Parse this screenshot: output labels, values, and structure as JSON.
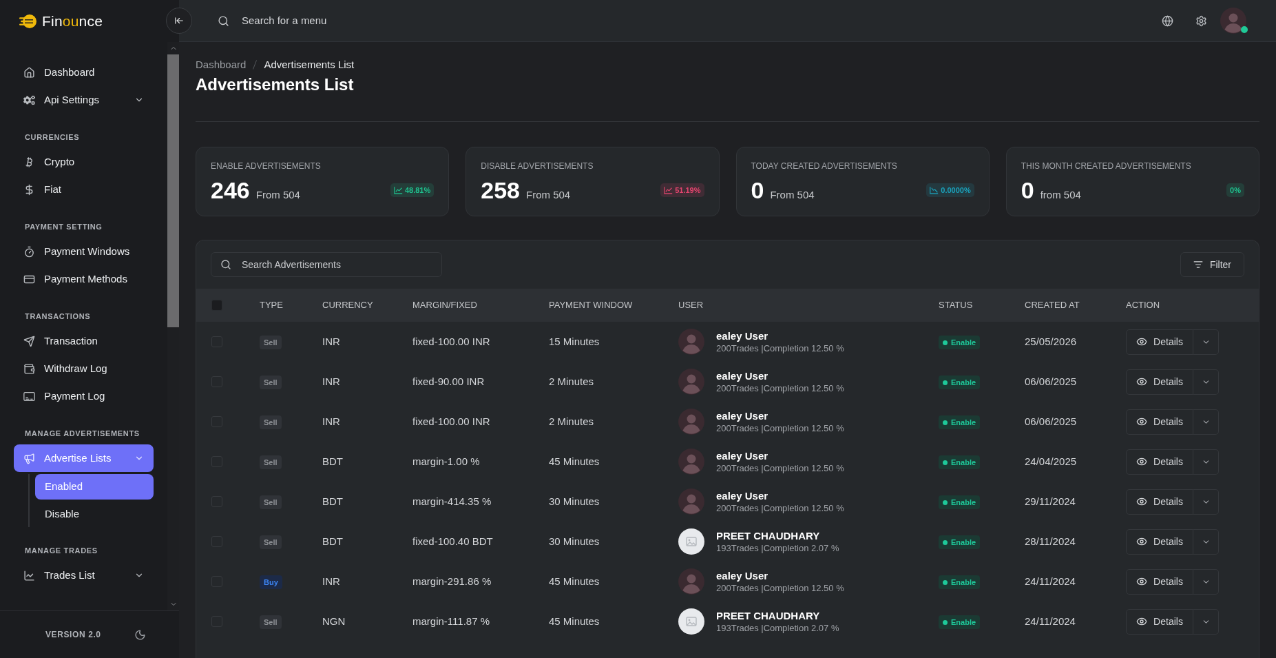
{
  "sidebar": {
    "logo": {
      "parts": [
        {
          "text": "Fin",
          "accent": false
        },
        {
          "text": "ou",
          "accent": true
        },
        {
          "text": "nce",
          "accent": false
        }
      ]
    },
    "sections": [
      {
        "items": [
          {
            "label": "Dashboard",
            "selected": false
          },
          {
            "label": "Api Settings",
            "selected": false,
            "expanded": false
          }
        ]
      },
      {
        "heading": "CURRENCIES",
        "items": [
          {
            "label": "Crypto",
            "selected": false
          },
          {
            "label": "Fiat",
            "selected": false
          }
        ]
      },
      {
        "heading": "PAYMENT SETTING",
        "items": [
          {
            "label": "Payment Windows",
            "selected": false
          },
          {
            "label": "Payment Methods",
            "selected": false
          }
        ]
      },
      {
        "heading": "TRANSACTIONS",
        "items": [
          {
            "label": "Transaction",
            "selected": false
          },
          {
            "label": "Withdraw Log",
            "selected": false
          },
          {
            "label": "Payment Log",
            "selected": false
          }
        ]
      },
      {
        "heading": "MANAGE ADVERTISEMENTS",
        "items": [
          {
            "label": "Advertise Lists",
            "selected": true,
            "expanded": true,
            "children": [
              {
                "label": "Enabled",
                "selected": true
              },
              {
                "label": "Disable",
                "selected": false
              }
            ]
          }
        ]
      },
      {
        "heading": "MANAGE TRADES",
        "items": [
          {
            "label": "Trades List",
            "selected": false,
            "expanded": false
          }
        ]
      }
    ],
    "version": "VERSION 2.0"
  },
  "header": {
    "search": {
      "placeholder": "Search for a menu"
    },
    "user": {
      "online": true
    }
  },
  "breadcrumb": [
    {
      "label": "Dashboard",
      "current": false
    },
    {
      "label": "Advertisements List",
      "current": true
    }
  ],
  "title": "Advertisements List",
  "stats": [
    {
      "kind": "rising",
      "label": "ENABLE ADVERTISEMENTS",
      "value": "246",
      "from": "From 504",
      "change": "48.81%",
      "color": "#1fc28f"
    },
    {
      "kind": "rising",
      "label": "DISABLE ADVERTISEMENTS",
      "value": "258",
      "from": "From 504",
      "change": "51.19%",
      "color": "#e5456f"
    },
    {
      "kind": "falling",
      "label": "TODAY CREATED ADVERTISEMENTS",
      "value": "0",
      "from": "From 504",
      "change": "0.0000%",
      "color": "#1ba3bd"
    },
    {
      "kind": "plain",
      "label": "THIS MONTH CREATED ADVERTISEMENTS",
      "value": "0",
      "from": "from 504",
      "change": "0%",
      "color": "#1fc28f"
    }
  ],
  "table": {
    "search": {
      "placeholder": "Search Advertisements"
    },
    "filter": "Filter",
    "select_all": {
      "checked": false
    },
    "columns": [
      "TYPE",
      "CURRENCY",
      "MARGIN/FIXED",
      "PAYMENT WINDOW",
      "USER",
      "STATUS",
      "CREATED AT",
      "ACTION"
    ],
    "rows": [
      {
        "checked": false,
        "type": {
          "label": "Sell",
          "kind": "sell"
        },
        "currency": "INR",
        "margin": "fixed-100.00 INR",
        "payment_window": "15 Minutes",
        "user": {
          "kind": "photo",
          "name": "ealey User",
          "stats": "200Trades |Completion 12.50 %"
        },
        "status": {
          "label": "Enable",
          "kind": "enabled"
        },
        "created_at": "25/05/2026",
        "action": "Details"
      },
      {
        "checked": false,
        "type": {
          "label": "Sell",
          "kind": "sell"
        },
        "currency": "INR",
        "margin": "fixed-90.00 INR",
        "payment_window": "2 Minutes",
        "user": {
          "kind": "photo",
          "name": "ealey User",
          "stats": "200Trades |Completion 12.50 %"
        },
        "status": {
          "label": "Enable",
          "kind": "enabled"
        },
        "created_at": "06/06/2025",
        "action": "Details"
      },
      {
        "checked": false,
        "type": {
          "label": "Sell",
          "kind": "sell"
        },
        "currency": "INR",
        "margin": "fixed-100.00 INR",
        "payment_window": "2 Minutes",
        "user": {
          "kind": "photo",
          "name": "ealey User",
          "stats": "200Trades |Completion 12.50 %"
        },
        "status": {
          "label": "Enable",
          "kind": "enabled"
        },
        "created_at": "06/06/2025",
        "action": "Details"
      },
      {
        "checked": false,
        "type": {
          "label": "Sell",
          "kind": "sell"
        },
        "currency": "BDT",
        "margin": "margin-1.00 %",
        "payment_window": "45 Minutes",
        "user": {
          "kind": "photo",
          "name": "ealey User",
          "stats": "200Trades |Completion 12.50 %"
        },
        "status": {
          "label": "Enable",
          "kind": "enabled"
        },
        "created_at": "24/04/2025",
        "action": "Details"
      },
      {
        "checked": false,
        "type": {
          "label": "Sell",
          "kind": "sell"
        },
        "currency": "BDT",
        "margin": "margin-414.35 %",
        "payment_window": "30 Minutes",
        "user": {
          "kind": "photo",
          "name": "ealey User",
          "stats": "200Trades |Completion 12.50 %"
        },
        "status": {
          "label": "Enable",
          "kind": "enabled"
        },
        "created_at": "29/11/2024",
        "action": "Details"
      },
      {
        "checked": false,
        "type": {
          "label": "Sell",
          "kind": "sell"
        },
        "currency": "BDT",
        "margin": "fixed-100.40 BDT",
        "payment_window": "30 Minutes",
        "user": {
          "kind": "placeholder",
          "name": "PREET CHAUDHARY",
          "stats": "193Trades |Completion 2.07 %"
        },
        "status": {
          "label": "Enable",
          "kind": "enabled"
        },
        "created_at": "28/11/2024",
        "action": "Details"
      },
      {
        "checked": false,
        "type": {
          "label": "Buy",
          "kind": "buy"
        },
        "currency": "INR",
        "margin": "margin-291.86 %",
        "payment_window": "45 Minutes",
        "user": {
          "kind": "photo",
          "name": "ealey User",
          "stats": "200Trades |Completion 12.50 %"
        },
        "status": {
          "label": "Enable",
          "kind": "enabled"
        },
        "created_at": "24/11/2024",
        "action": "Details"
      },
      {
        "checked": false,
        "type": {
          "label": "Sell",
          "kind": "sell"
        },
        "currency": "NGN",
        "margin": "margin-111.87 %",
        "payment_window": "45 Minutes",
        "user": {
          "kind": "placeholder",
          "name": "PREET CHAUDHARY",
          "stats": "193Trades |Completion 2.07 %"
        },
        "status": {
          "label": "Enable",
          "kind": "enabled"
        },
        "created_at": "24/11/2024",
        "action": "Details"
      }
    ]
  }
}
